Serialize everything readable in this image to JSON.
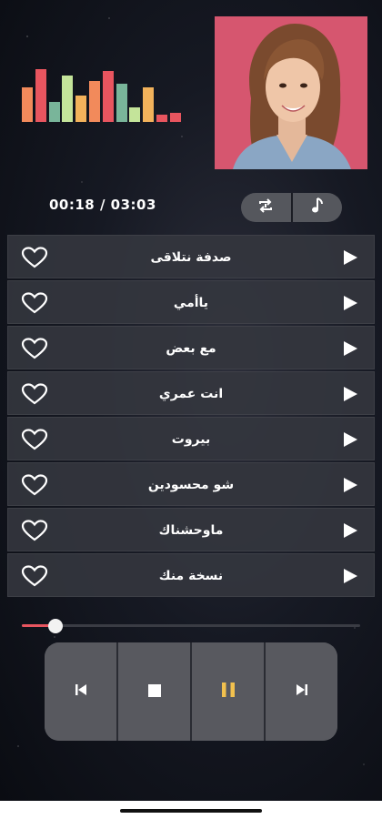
{
  "player": {
    "elapsed": "00:18",
    "total": "03:03",
    "time_display": "00:18 / 03:03",
    "progress": 0.1
  },
  "visualizer": {
    "levels": [
      0.6,
      0.9,
      0.35,
      0.8,
      0.45,
      0.7,
      0.88,
      0.65,
      0.25,
      0.6,
      0.12,
      0.15
    ],
    "colors": [
      "#f28a5b",
      "#e8555f",
      "#79b59a",
      "#c4e49a",
      "#f2b25b",
      "#f28a5b",
      "#e8555f",
      "#79b59a",
      "#c4e49a",
      "#f2b25b",
      "#e8555f",
      "#e8555f"
    ]
  },
  "playlist": [
    {
      "title": "صدفة نتلاقى"
    },
    {
      "title": "ياأمي"
    },
    {
      "title": "مع بعض"
    },
    {
      "title": "انت عمري"
    },
    {
      "title": "بيروت"
    },
    {
      "title": "شو محسودين"
    },
    {
      "title": "ماوحشناك"
    },
    {
      "title": "نسخة منك"
    }
  ],
  "icons": {
    "repeat": "repeat-icon",
    "music": "music-note-icon",
    "favorite": "heart-icon",
    "play": "play-icon",
    "previous": "skip-previous-icon",
    "stop": "stop-icon",
    "pause": "pause-icon",
    "next": "skip-next-icon"
  },
  "colors": {
    "accent": "#e8555f",
    "pause": "#f2c14e",
    "album_bg": "#d6566f"
  }
}
